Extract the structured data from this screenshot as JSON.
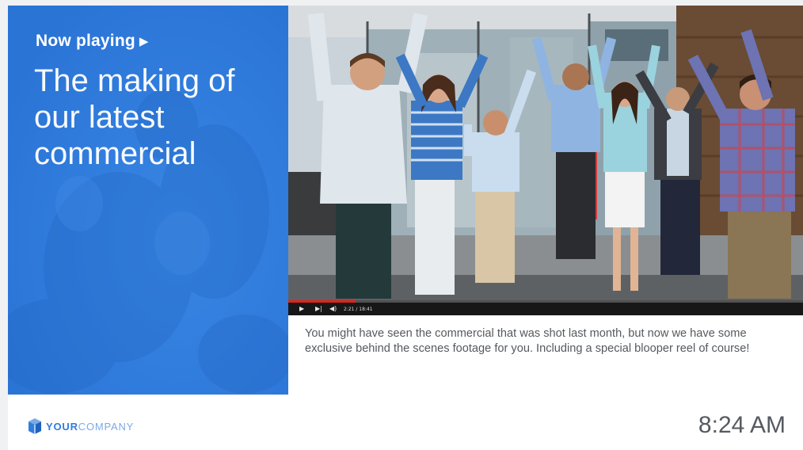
{
  "hero": {
    "now_playing_label": "Now playing",
    "play_icon": "▶",
    "title": "The making of our latest commercial"
  },
  "video": {
    "description": "People jumping in an office",
    "progress_fraction": 0.13,
    "controls": {
      "play_icon": "play-icon",
      "next_icon": "skip-next-icon",
      "volume_icon": "volume-icon",
      "time": "2:21 / 18:41"
    }
  },
  "description": "You might have seen the commercial that was shot last month, but now we have some exclusive behind the scenes footage for you. Including a special blooper reel of course!",
  "footer": {
    "logo_your": "YOUR",
    "logo_company": "COMPANY",
    "clock": "8:24 AM"
  },
  "colors": {
    "brand_blue": "#2f7ddf",
    "brand_light_blue": "#7aaae8",
    "progress_red": "#e62117",
    "text_gray": "#55595e"
  }
}
